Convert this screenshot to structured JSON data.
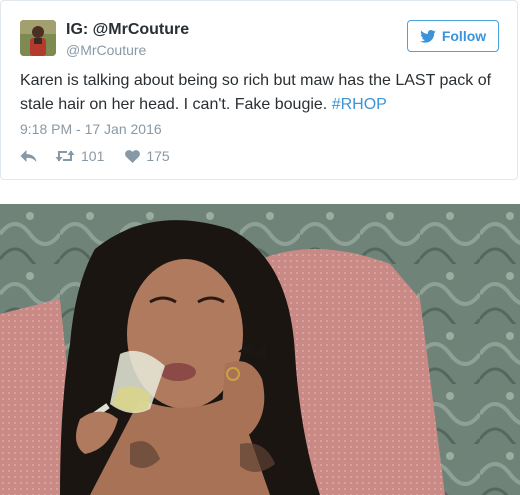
{
  "tweet": {
    "display_name": "IG: @MrCouture",
    "handle": "@MrCouture",
    "follow_label": "Follow",
    "text": "Karen is talking about being so rich but maw has the LAST pack of stale hair on her head. I can't. Fake bougie. ",
    "hashtag": "#RHOP",
    "timestamp": "9:18 PM - 17 Jan 2016",
    "retweet_count": "101",
    "like_count": "175"
  },
  "icons": {
    "follow": "twitter-bird-icon",
    "reply": "reply-icon",
    "retweet": "retweet-icon",
    "like": "heart-icon"
  },
  "colors": {
    "accent": "#3b94d9",
    "text": "#292f33",
    "muted": "#8899a6",
    "border": "#e1e8ed"
  }
}
